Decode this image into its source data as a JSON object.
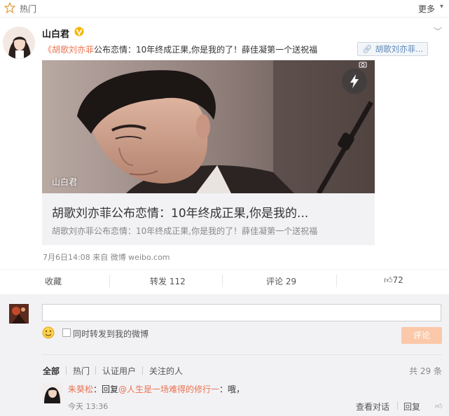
{
  "topbar": {
    "hot_label": "热门",
    "more_label": "更多"
  },
  "post": {
    "username": "山白君",
    "text_open": "《",
    "text_link": "胡歌刘亦菲",
    "text_rest": "公布恋情：10年终成正果,你是我的了！薛佳凝第一个送祝福",
    "tag_label": "胡歌刘亦菲...",
    "image_caption": "山白君",
    "link_title": "胡歌刘亦菲公布恋情：10年终成正果,你是我的...",
    "link_sub": "胡歌刘亦菲公布恋情：10年终成正果,你是我的了！薛佳凝第一个送祝福",
    "meta": "7月6日14:08 来自 微博 weibo.com"
  },
  "actions": {
    "favorite": "收藏",
    "repost": "转发 112",
    "comment": "评论 29",
    "like": "72"
  },
  "composer": {
    "checkbox_label": "同时转发到我的微博",
    "submit_label": "评论"
  },
  "filters": {
    "all": "全部",
    "hot": "热门",
    "verified": "认证用户",
    "following": "关注的人",
    "total": "共 29 条"
  },
  "comment": {
    "user": "朱葵松",
    "reply_prefix": "：回复",
    "reply_to": "@人生是一场难得的修行一",
    "content": "：哦，",
    "time": "今天 13:36",
    "view_thread": "查看对话",
    "reply": "回复"
  },
  "colors": {
    "accent_orange": "#eb7350",
    "link_blue": "#5d87b8",
    "submit_disabled": "#fbc8a9"
  }
}
